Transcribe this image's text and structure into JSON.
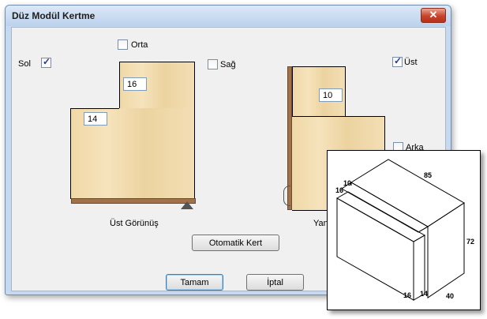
{
  "window": {
    "title": "Düz Modül Kertme",
    "close_glyph": "✕"
  },
  "checkboxes": {
    "orta": {
      "label": "Orta",
      "checked": false
    },
    "sol": {
      "label": "Sol",
      "checked": true
    },
    "sag": {
      "label": "Sağ",
      "checked": false
    },
    "ust": {
      "label": "Üst",
      "checked": true
    },
    "arka": {
      "label": "Arka",
      "checked": false
    }
  },
  "top_view": {
    "label": "Üst Görünüş",
    "input_top": "16",
    "input_left": "14"
  },
  "side_view": {
    "label": "Yan",
    "input": "10"
  },
  "buttons": {
    "auto": "Otomatik Kert",
    "ok": "Tamam",
    "cancel": "İptal"
  },
  "iso_dims": {
    "d85": "85",
    "d10": "10",
    "d16a": "16",
    "d72": "72",
    "d16b": "16",
    "d14": "14",
    "d40": "40"
  },
  "colors": {
    "wood": "#f2dcae",
    "edge": "#a0714a"
  }
}
